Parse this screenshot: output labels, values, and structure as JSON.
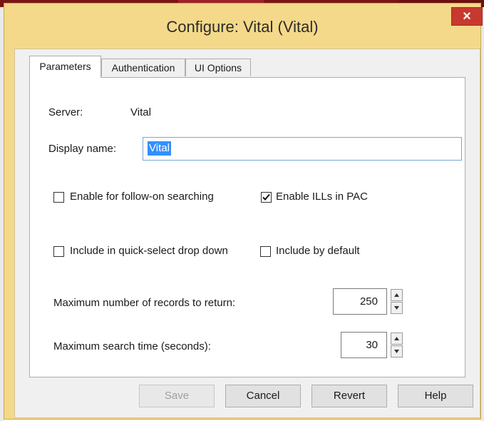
{
  "window": {
    "title": "Configure: Vital (Vital)",
    "close_symbol": "×"
  },
  "tabs": [
    {
      "label": "Parameters"
    },
    {
      "label": "Authentication"
    },
    {
      "label": "UI Options"
    }
  ],
  "parameters": {
    "server_label": "Server:",
    "server_value": "Vital",
    "display_name_label": "Display name:",
    "display_name_value": "Vital",
    "follow_on_label": "Enable for follow-on searching",
    "follow_on_checked": false,
    "ills_label": "Enable ILLs in PAC",
    "ills_checked": true,
    "quick_select_label": "Include in quick-select drop down",
    "quick_select_checked": false,
    "default_label": "Include by default",
    "default_checked": false,
    "max_records_label": "Maximum number of records to return:",
    "max_records_value": "250",
    "max_time_label": "Maximum search time (seconds):",
    "max_time_value": "30"
  },
  "buttons": {
    "save": "Save",
    "cancel": "Cancel",
    "revert": "Revert",
    "help": "Help"
  },
  "colors": {
    "title_bar": "#f5d98a",
    "close_button": "#c7392f",
    "selection": "#3390ff"
  }
}
